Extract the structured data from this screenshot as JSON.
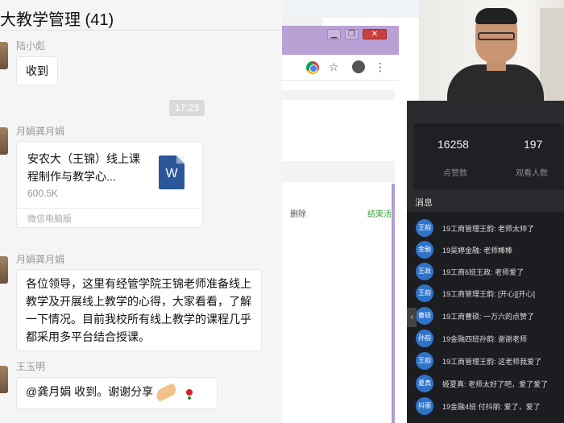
{
  "chat": {
    "title": "大教学管理 (41)",
    "messages": [
      {
        "sender": "陆小彪",
        "text": "收到"
      },
      {
        "sender": "月娟龚月娟",
        "file": {
          "name": "安农大（王锦）线上课程制作与教学心...",
          "size": "600.5K",
          "icon": "W",
          "source": "微信电脑版"
        }
      },
      {
        "sender": "月娟龚月娟",
        "text": "各位领导，这里有经管学院王锦老师准备线上教学及开展线上教学的心得，大家看看，了解一下情况。目前我校所有线上教学的课程几乎都采用多平台结合授课。"
      },
      {
        "sender": "王玉明",
        "text": "@龚月娟 收到。谢谢分享"
      }
    ],
    "timestamp": "17:23"
  },
  "browser": {
    "window_buttons": [
      "▁",
      "❐",
      "✕"
    ],
    "row_delete": "删除",
    "row_status": "结束活"
  },
  "live": {
    "likes": "16258",
    "likes_label": "点赞数",
    "viewers": "197",
    "viewers_label": "观看人数",
    "messages_title": "消息",
    "messages": [
      {
        "badge": "王韵",
        "text": "19工商管理王韵: 老师太帅了"
      },
      {
        "badge": "金融",
        "text": "19吴婷金融: 老师棒棒"
      },
      {
        "badge": "王政",
        "text": "19工商6班王政: 老师爱了"
      },
      {
        "badge": "王韵",
        "text": "19工商管理王韵: [开心][开心]"
      },
      {
        "badge": "曹硕",
        "text": "19工商曹硕: 一万六的点赞了"
      },
      {
        "badge": "孙韵",
        "text": "19金融四班孙韵: 谢谢老师"
      },
      {
        "badge": "王韵",
        "text": "19工商管理王韵: 这老师我爱了"
      },
      {
        "badge": "夏真",
        "text": "姬夏真: 老师太好了吧，爱了爱了"
      },
      {
        "badge": "抖丽",
        "text": "19金融4班 付抖丽: 爱了，爱了"
      }
    ]
  }
}
